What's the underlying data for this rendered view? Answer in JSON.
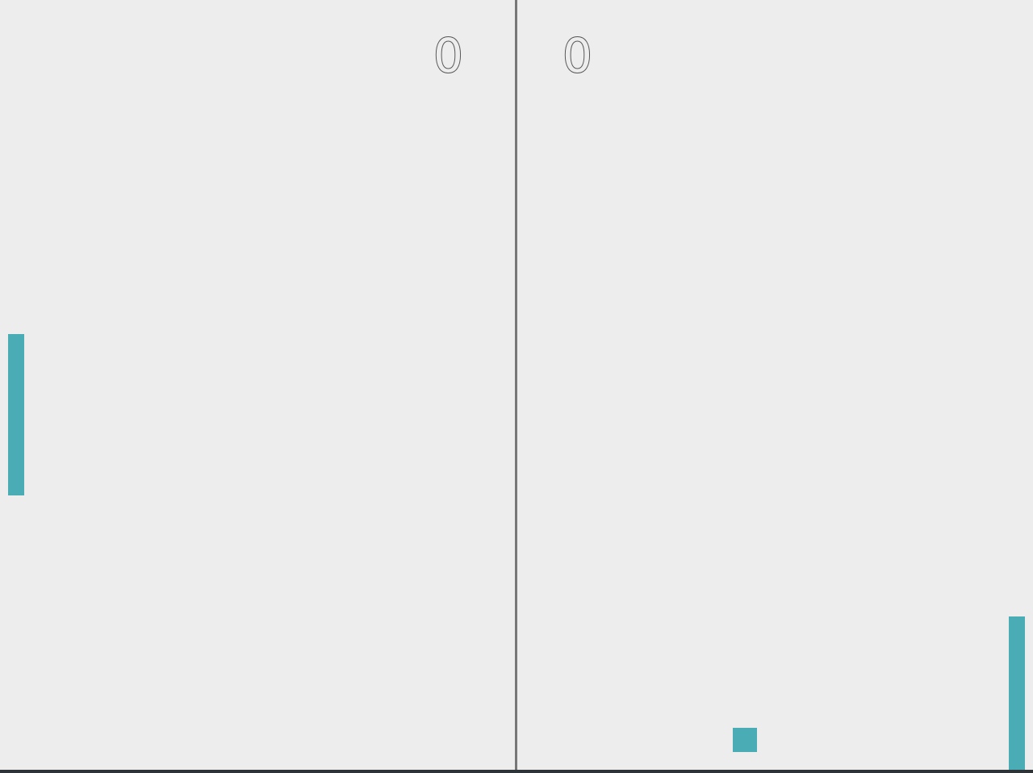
{
  "scores": {
    "left": "0",
    "right": "0"
  },
  "colors": {
    "background": "#ededed",
    "net": "#777777",
    "paddle": "#4aadb6",
    "ball": "#4aadb6",
    "score_outline": "#555555",
    "border": "#2e3338"
  }
}
